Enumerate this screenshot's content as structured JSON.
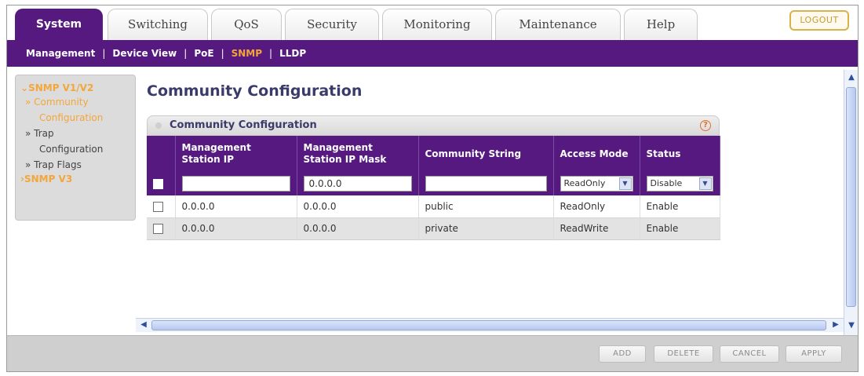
{
  "tabs": [
    {
      "label": "System"
    },
    {
      "label": "Switching"
    },
    {
      "label": "QoS"
    },
    {
      "label": "Security"
    },
    {
      "label": "Monitoring"
    },
    {
      "label": "Maintenance"
    },
    {
      "label": "Help"
    }
  ],
  "logout_label": "LOGOUT",
  "submenu": [
    {
      "label": "Management"
    },
    {
      "label": "Device View"
    },
    {
      "label": "PoE"
    },
    {
      "label": "SNMP"
    },
    {
      "label": "LLDP"
    }
  ],
  "leftnav": {
    "head1": "SNMP V1/V2",
    "item1_a": "» Community",
    "item1_b": "Configuration",
    "item2_a": "» Trap",
    "item2_b": "Configuration",
    "item3": "» Trap Flags",
    "head2": "SNMP V3"
  },
  "page_title": "Community Configuration",
  "panel": {
    "title": "Community Configuration",
    "help_icon": "?"
  },
  "table": {
    "headers": [
      "Management Station IP",
      "Management Station IP Mask",
      "Community String",
      "Access Mode",
      "Status"
    ],
    "input_row": {
      "ip": "",
      "mask": "0.0.0.0",
      "community": "",
      "access": "ReadOnly",
      "status": "Disable"
    },
    "rows": [
      {
        "ip": "0.0.0.0",
        "mask": "0.0.0.0",
        "community": "public",
        "access": "ReadOnly",
        "status": "Enable"
      },
      {
        "ip": "0.0.0.0",
        "mask": "0.0.0.0",
        "community": "private",
        "access": "ReadWrite",
        "status": "Enable"
      }
    ]
  },
  "buttons": {
    "add": "ADD",
    "delete": "DELETE",
    "cancel": "CANCEL",
    "apply": "APPLY"
  },
  "colors": {
    "brand_purple": "#55197f",
    "accent_orange": "#f3a63a"
  }
}
